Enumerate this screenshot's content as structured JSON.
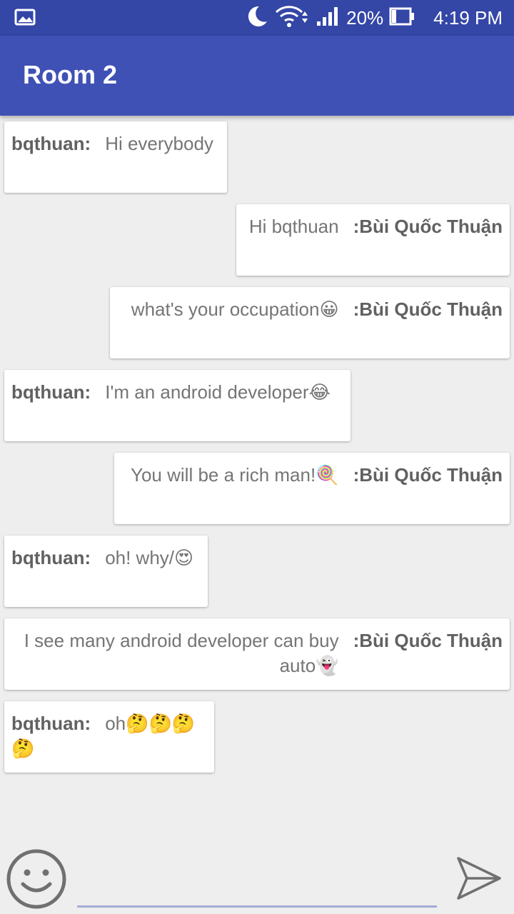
{
  "status_bar": {
    "battery": "20%",
    "time": "4:19 PM",
    "icons": [
      "gallery-icon",
      "moon-icon",
      "wifi-icon",
      "signal-icon",
      "battery-icon"
    ]
  },
  "app_bar": {
    "title": "Room 2"
  },
  "colors": {
    "status_bar": "#3446a6",
    "app_bar": "#3f51b5",
    "background": "#eeeeee"
  },
  "messages": [
    {
      "side": "left",
      "sender": "bqthuan:",
      "text": "Hi everybody"
    },
    {
      "side": "right",
      "sender": ":Bùi Quốc Thuận",
      "text": "Hi bqthuan"
    },
    {
      "side": "right",
      "sender": ":Bùi Quốc Thuận",
      "text": "what's your occupation😀"
    },
    {
      "side": "left",
      "sender": "bqthuan:",
      "text": "I'm an android developer😂"
    },
    {
      "side": "right",
      "sender": ":Bùi Quốc Thuận",
      "text": "You will be a rich man!🍭"
    },
    {
      "side": "left",
      "sender": "bqthuan:",
      "text": "oh! why/😍"
    },
    {
      "side": "right",
      "sender": ":Bùi Quốc Thuận",
      "text": "I see many android developer can buy auto👻"
    },
    {
      "side": "left",
      "sender": "bqthuan:",
      "text": "oh🤔🤔🤔🤔"
    }
  ],
  "composer": {
    "input_value": "",
    "icons": [
      "smiley-icon",
      "send-icon"
    ]
  }
}
